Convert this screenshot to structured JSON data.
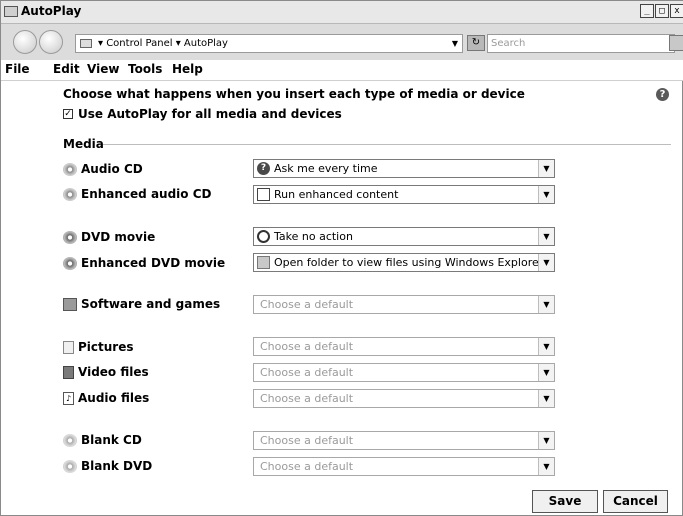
{
  "window": {
    "title": "AutoPlay"
  },
  "address_bar": {
    "crumb_root": "Control Panel",
    "crumb_current": "AutoPlay",
    "search_placeholder": "Search"
  },
  "menu": [
    "File",
    "Edit",
    "View",
    "Tools",
    "Help"
  ],
  "content": {
    "heading": "Choose what happens when you insert each type of media or device",
    "use_autoplay_label": "Use AutoPlay for all media and devices",
    "use_autoplay_checked": true,
    "section_label": "Media",
    "rows": [
      {
        "label": "Audio CD",
        "icon": "cd-icon",
        "value": "Ask me every time",
        "value_icon": "question-icon",
        "disabled": false
      },
      {
        "label": "Enhanced audio CD",
        "icon": "cd-icon",
        "value": "Run enhanced content",
        "value_icon": "window-icon",
        "disabled": false
      },
      {
        "label": "DVD movie",
        "icon": "dvd-icon",
        "value": "Take no action",
        "value_icon": "no-action-icon",
        "disabled": false
      },
      {
        "label": "Enhanced DVD movie",
        "icon": "dvd-icon",
        "value": "Open folder to view files using Windows Explorer",
        "value_icon": "folder-icon",
        "disabled": false
      },
      {
        "label": "Software and games",
        "icon": "software-icon",
        "value": "Choose a default",
        "disabled": true
      },
      {
        "label": "Pictures",
        "icon": "picture-icon",
        "value": "Choose a default",
        "disabled": true
      },
      {
        "label": "Video files",
        "icon": "video-icon",
        "value": "Choose a default",
        "disabled": true
      },
      {
        "label": "Audio files",
        "icon": "audio-file-icon",
        "value": "Choose a default",
        "disabled": true
      },
      {
        "label": "Blank CD",
        "icon": "blank-cd-icon",
        "value": "Choose a default",
        "disabled": true
      },
      {
        "label": "Blank DVD",
        "icon": "blank-dvd-icon",
        "value": "Choose a default",
        "disabled": true
      }
    ]
  },
  "buttons": {
    "save": "Save",
    "cancel": "Cancel"
  }
}
